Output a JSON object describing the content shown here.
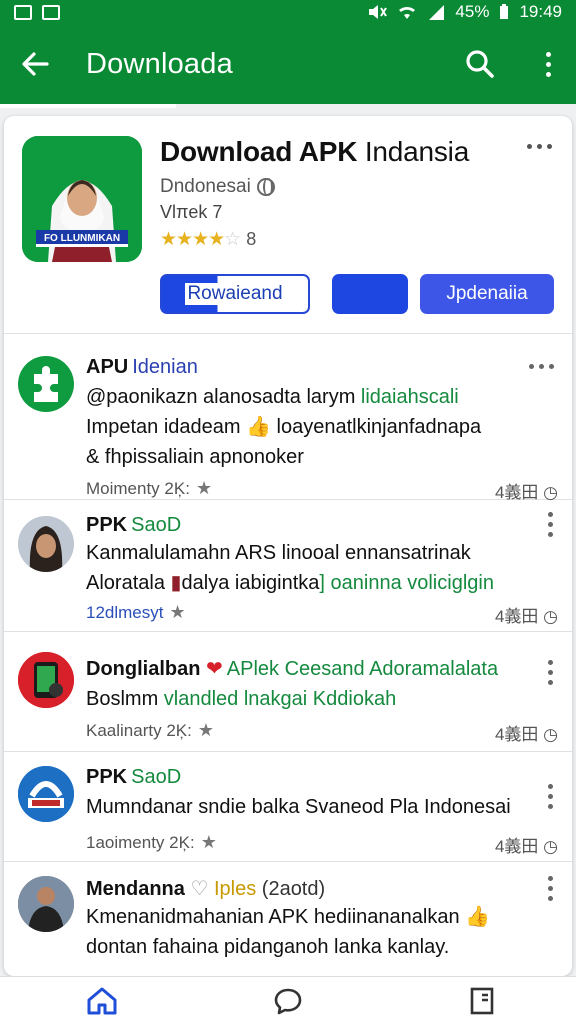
{
  "status_bar": {
    "time": "19:49",
    "battery_text": "45%"
  },
  "app_bar": {
    "title": "Downloada"
  },
  "hero": {
    "title_bold": "Download APK",
    "title_rest": " Indansia",
    "developer": "Dndonesai",
    "version": "Vlπek 7",
    "rating_value": "8",
    "icon_banner": "FO LLUNMIKAN",
    "download_label": "Rowaieand",
    "update_label": "Jpdenaiia"
  },
  "posts": [
    {
      "name": "APU",
      "tag": "Idenian",
      "line1_a": "@paonikazn alanosadta",
      "line1_b": " larym ",
      "line1_c": "lidaiahscali",
      "line2": "Impetan idadeam 👍 loayenatlkinjanfadnapa",
      "line3": "& fhpissaliain apnonoker️",
      "meta": "Moimenty 2Ķ:",
      "count": "4義田"
    },
    {
      "name": "PPK",
      "tag": "SaoD",
      "line1": "Kanmalulamahn ARS linooal ennansatrinak",
      "line2_a": "Aloratala ",
      "line2_b": "dalya iabigintka",
      "line2_c": "] oaninna voliciglgin",
      "meta": "12dlmesyt",
      "count": "4義田"
    },
    {
      "name": "Donglialban",
      "tag": "APlek Ceesand Adoramalalata",
      "line1_a": "Boslmm ",
      "line1_b": "vlandled lnakgai Kddiokah",
      "meta": "Kaalinarty 2Ķ:",
      "count": "4義田"
    },
    {
      "name": "PPK",
      "tag": "SaoD",
      "line1": "Mumndanar sndie balka Svaneod Pla Indonesai",
      "meta": "1aoimenty 2Ķ:",
      "count": "4義田"
    },
    {
      "name": "Mendanna",
      "tag": "Iples",
      "tag_extra": "(2aotd)",
      "line1": "Kmenanidmahanian APK hediinananalkan 👍",
      "line2": "dontan fahaina pidanganoh lanka kanlay.",
      "meta": "",
      "count": ""
    }
  ]
}
